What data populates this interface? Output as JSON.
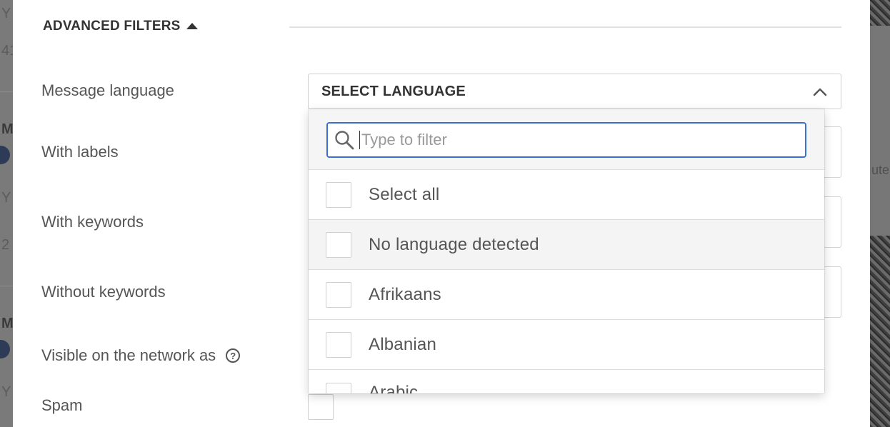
{
  "background": {
    "left_fragments": [
      "Y",
      "41",
      "M",
      "Y",
      "2",
      "M",
      "Y"
    ],
    "right_fragments": [
      "ute"
    ]
  },
  "filters": {
    "section_title": "ADVANCED FILTERS",
    "rows": {
      "message_language": "Message language",
      "with_labels": "With labels",
      "with_keywords": "With keywords",
      "without_keywords": "Without keywords",
      "visible_as": "Visible on the network as",
      "spam": "Spam"
    },
    "help_glyph": "?"
  },
  "language_select": {
    "label": "SELECT LANGUAGE",
    "filter_placeholder": "Type to filter",
    "filter_value": "",
    "options": [
      {
        "label": "Select all",
        "checked": false
      },
      {
        "label": "No language detected",
        "checked": false
      },
      {
        "label": "Afrikaans",
        "checked": false
      },
      {
        "label": "Albanian",
        "checked": false
      },
      {
        "label": "Arabic",
        "checked": false
      }
    ]
  },
  "colors": {
    "focus_border": "#3d6fd1",
    "text_primary": "#333333",
    "text_secondary": "#555555"
  }
}
